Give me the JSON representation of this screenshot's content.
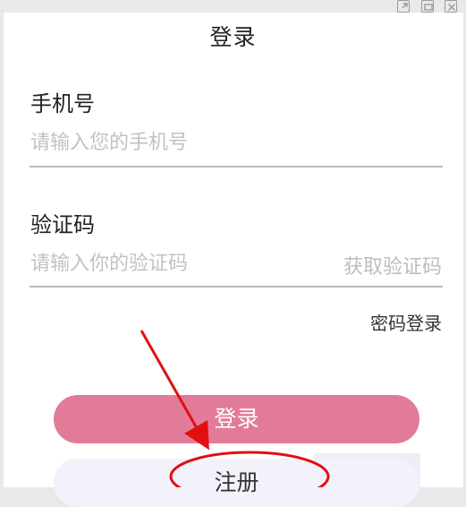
{
  "window": {
    "controls": [
      "popout-icon",
      "minimize-icon",
      "close-icon"
    ]
  },
  "title": "登录",
  "phone": {
    "label": "手机号",
    "placeholder": "请输入您的手机号"
  },
  "code": {
    "label": "验证码",
    "placeholder": "请输入你的验证码",
    "get_code": "获取验证码"
  },
  "password_login": "密码登录",
  "buttons": {
    "login": "登录",
    "register": "注册"
  },
  "colors": {
    "login_button": "#e27b98",
    "register_button": "#f1f2fa",
    "annotation": "#e01010"
  }
}
